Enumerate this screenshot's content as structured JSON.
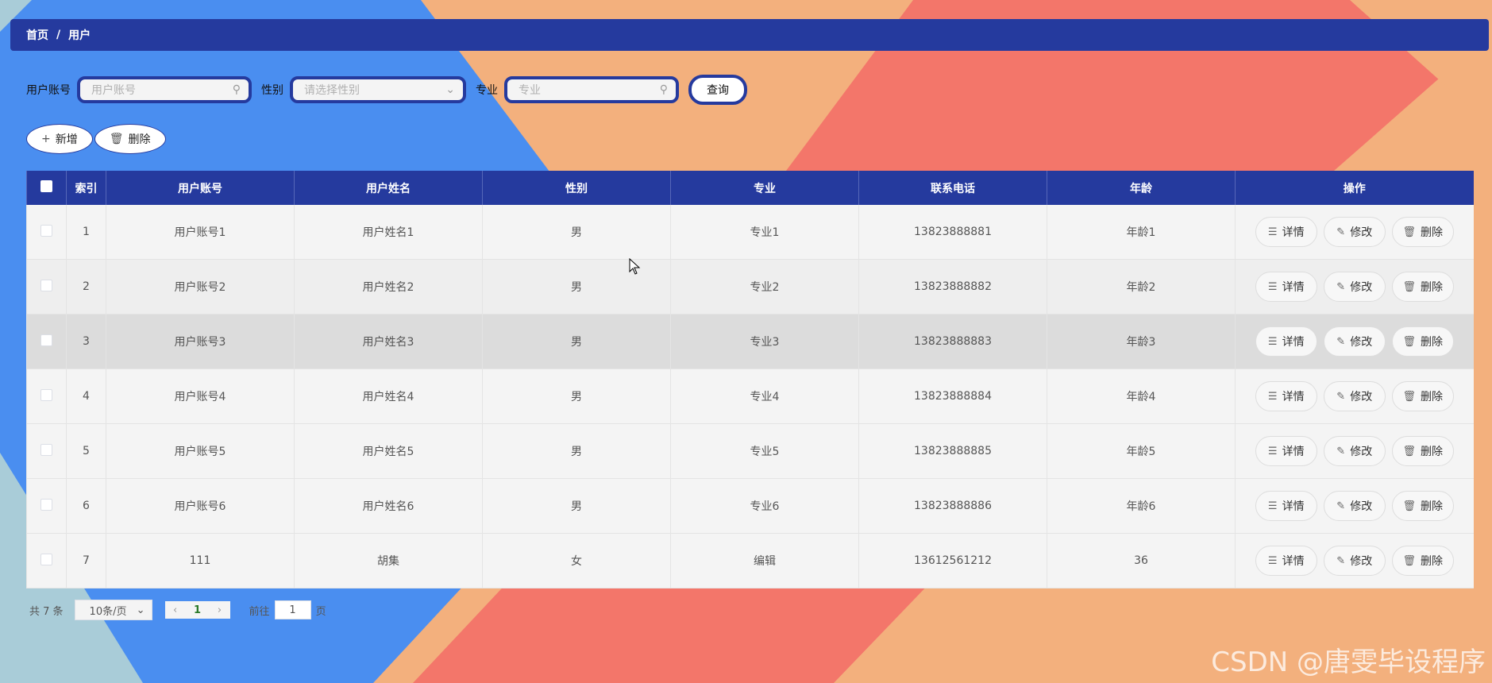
{
  "colors": {
    "primary": "#253a9e",
    "bg_blue": "#4a8ef0",
    "bg_peach": "#f3b07d",
    "bg_coral": "#f3766a",
    "bg_teal": "#a9ccd8"
  },
  "breadcrumb": {
    "home": "首页",
    "separator": "/",
    "current": "用户"
  },
  "search": {
    "account_label": "用户账号",
    "account_placeholder": "用户账号",
    "gender_label": "性别",
    "gender_placeholder": "请选择性别",
    "major_label": "专业",
    "major_placeholder": "专业",
    "query_button": "查询"
  },
  "actions": {
    "add_label": "新增",
    "delete_label": "删除"
  },
  "table": {
    "headers": {
      "index": "索引",
      "account": "用户账号",
      "name": "用户姓名",
      "gender": "性别",
      "major": "专业",
      "phone": "联系电话",
      "age": "年龄",
      "ops": "操作"
    },
    "op_labels": {
      "detail": "详情",
      "edit": "修改",
      "delete": "删除"
    },
    "rows": [
      {
        "index": "1",
        "account": "用户账号1",
        "name": "用户姓名1",
        "gender": "男",
        "major": "专业1",
        "phone": "13823888881",
        "age": "年龄1"
      },
      {
        "index": "2",
        "account": "用户账号2",
        "name": "用户姓名2",
        "gender": "男",
        "major": "专业2",
        "phone": "13823888882",
        "age": "年龄2"
      },
      {
        "index": "3",
        "account": "用户账号3",
        "name": "用户姓名3",
        "gender": "男",
        "major": "专业3",
        "phone": "13823888883",
        "age": "年龄3"
      },
      {
        "index": "4",
        "account": "用户账号4",
        "name": "用户姓名4",
        "gender": "男",
        "major": "专业4",
        "phone": "13823888884",
        "age": "年龄4"
      },
      {
        "index": "5",
        "account": "用户账号5",
        "name": "用户姓名5",
        "gender": "男",
        "major": "专业5",
        "phone": "13823888885",
        "age": "年龄5"
      },
      {
        "index": "6",
        "account": "用户账号6",
        "name": "用户姓名6",
        "gender": "男",
        "major": "专业6",
        "phone": "13823888886",
        "age": "年龄6"
      },
      {
        "index": "7",
        "account": "111",
        "name": "胡集",
        "gender": "女",
        "major": "编辑",
        "phone": "13612561212",
        "age": "36"
      }
    ]
  },
  "pagination": {
    "total_text": "共 7 条",
    "page_size": "10条/页",
    "current_page": "1",
    "goto_prefix": "前往",
    "goto_value": "1",
    "goto_suffix": "页"
  },
  "watermark": "CSDN @唐雯毕设程序"
}
